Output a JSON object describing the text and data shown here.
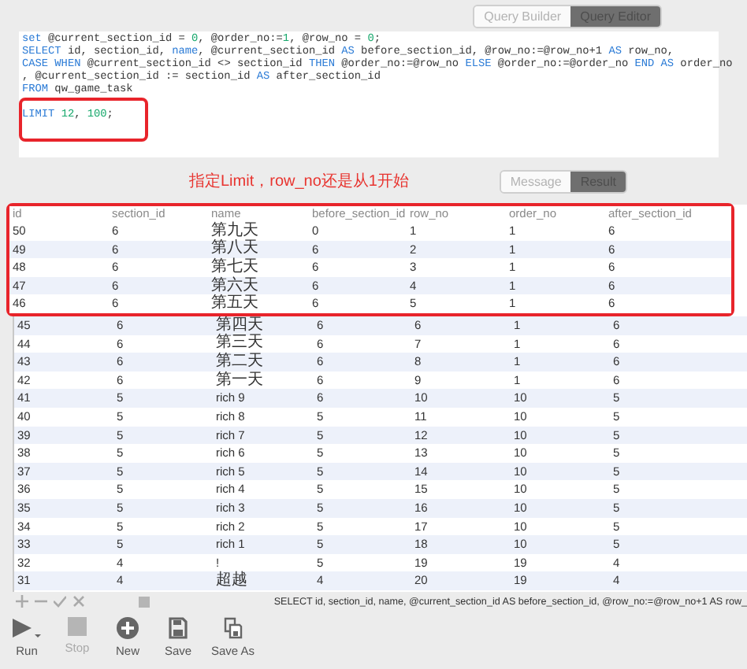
{
  "mode_tabs": [
    {
      "label": "Query Builder",
      "selected": false
    },
    {
      "label": "Query Editor",
      "selected": true
    }
  ],
  "editor": {
    "lines": [
      [
        {
          "kind": "keyword",
          "text": "set"
        },
        {
          "kind": "plain",
          "text": " @current_section_id = "
        },
        {
          "kind": "number",
          "text": "0"
        },
        {
          "kind": "plain",
          "text": ", @order_no:="
        },
        {
          "kind": "number",
          "text": "1"
        },
        {
          "kind": "plain",
          "text": ", @row_no = "
        },
        {
          "kind": "number",
          "text": "0"
        },
        {
          "kind": "plain",
          "text": ";"
        }
      ],
      [
        {
          "kind": "keyword",
          "text": "SELECT"
        },
        {
          "kind": "plain",
          "text": " id, section_id, "
        },
        {
          "kind": "keyword",
          "text": "name"
        },
        {
          "kind": "plain",
          "text": ", @current_section_id "
        },
        {
          "kind": "keyword",
          "text": "AS"
        },
        {
          "kind": "plain",
          "text": " before_section_id, @row_no:=@row_no+1 "
        },
        {
          "kind": "keyword",
          "text": "AS"
        },
        {
          "kind": "plain",
          "text": " row_no,"
        }
      ],
      [
        {
          "kind": "keyword",
          "text": "CASE WHEN"
        },
        {
          "kind": "plain",
          "text": " @current_section_id <> section_id "
        },
        {
          "kind": "keyword",
          "text": "THEN"
        },
        {
          "kind": "plain",
          "text": " @order_no:=@row_no "
        },
        {
          "kind": "keyword",
          "text": "ELSE"
        },
        {
          "kind": "plain",
          "text": " @order_no:=@order_no "
        },
        {
          "kind": "keyword",
          "text": "END AS"
        },
        {
          "kind": "plain",
          "text": " order_no"
        }
      ],
      [
        {
          "kind": "plain",
          "text": ", @current_section_id := section_id "
        },
        {
          "kind": "keyword",
          "text": "AS"
        },
        {
          "kind": "plain",
          "text": " after_section_id"
        }
      ],
      [
        {
          "kind": "keyword",
          "text": "FROM"
        },
        {
          "kind": "plain",
          "text": " qw_game_task"
        }
      ],
      [
        {
          "kind": "keyword",
          "text": "LIMIT"
        },
        {
          "kind": "number",
          "text": " 12"
        },
        {
          "kind": "plain",
          "text": ", "
        },
        {
          "kind": "number",
          "text": "100"
        },
        {
          "kind": "plain",
          "text": ";"
        }
      ]
    ]
  },
  "annotation": "指定Limit，row_no还是从1开始",
  "result_tabs": [
    {
      "label": "Message",
      "selected": false
    },
    {
      "label": "Result",
      "selected": true
    }
  ],
  "table": {
    "columns": [
      "id",
      "section_id",
      "name",
      "before_section_id",
      "row_no",
      "order_no",
      "after_section_id"
    ],
    "rows": [
      [
        "50",
        "6",
        "第九天",
        "0",
        "1",
        "1",
        "6"
      ],
      [
        "49",
        "6",
        "第八天",
        "6",
        "2",
        "1",
        "6"
      ],
      [
        "48",
        "6",
        "第七天",
        "6",
        "3",
        "1",
        "6"
      ],
      [
        "47",
        "6",
        "第六天",
        "6",
        "4",
        "1",
        "6"
      ],
      [
        "46",
        "6",
        "第五天",
        "6",
        "5",
        "1",
        "6"
      ],
      [
        "45",
        "6",
        "第四天",
        "6",
        "6",
        "1",
        "6"
      ],
      [
        "44",
        "6",
        "第三天",
        "6",
        "7",
        "1",
        "6"
      ],
      [
        "43",
        "6",
        "第二天",
        "6",
        "8",
        "1",
        "6"
      ],
      [
        "42",
        "6",
        "第一天",
        "6",
        "9",
        "1",
        "6"
      ],
      [
        "41",
        "5",
        "rich 9",
        "6",
        "10",
        "10",
        "5"
      ],
      [
        "40",
        "5",
        "rich 8",
        "5",
        "11",
        "10",
        "5"
      ],
      [
        "39",
        "5",
        "rich 7",
        "5",
        "12",
        "10",
        "5"
      ],
      [
        "38",
        "5",
        "rich 6",
        "5",
        "13",
        "10",
        "5"
      ],
      [
        "37",
        "5",
        "rich 5",
        "5",
        "14",
        "10",
        "5"
      ],
      [
        "36",
        "5",
        "rich 4",
        "5",
        "15",
        "10",
        "5"
      ],
      [
        "35",
        "5",
        "rich 3",
        "5",
        "16",
        "10",
        "5"
      ],
      [
        "34",
        "5",
        "rich 2",
        "5",
        "17",
        "10",
        "5"
      ],
      [
        "33",
        "5",
        "rich 1",
        "5",
        "18",
        "10",
        "5"
      ],
      [
        "32",
        "4",
        "!",
        "5",
        "19",
        "19",
        "4"
      ],
      [
        "31",
        "4",
        "超越",
        "4",
        "20",
        "19",
        "4"
      ]
    ]
  },
  "status_query": "SELECT id, section_id, name, @current_section_id AS before_section_id, @row_no:=@row_no+1 AS row_",
  "toolbar": [
    {
      "kind": "run",
      "label": "Run",
      "disabled": false
    },
    {
      "kind": "stop",
      "label": "Stop",
      "disabled": true
    },
    {
      "kind": "new",
      "label": "New",
      "disabled": false
    },
    {
      "kind": "save",
      "label": "Save",
      "disabled": false
    },
    {
      "kind": "saveas",
      "label": "Save As",
      "disabled": false
    }
  ]
}
